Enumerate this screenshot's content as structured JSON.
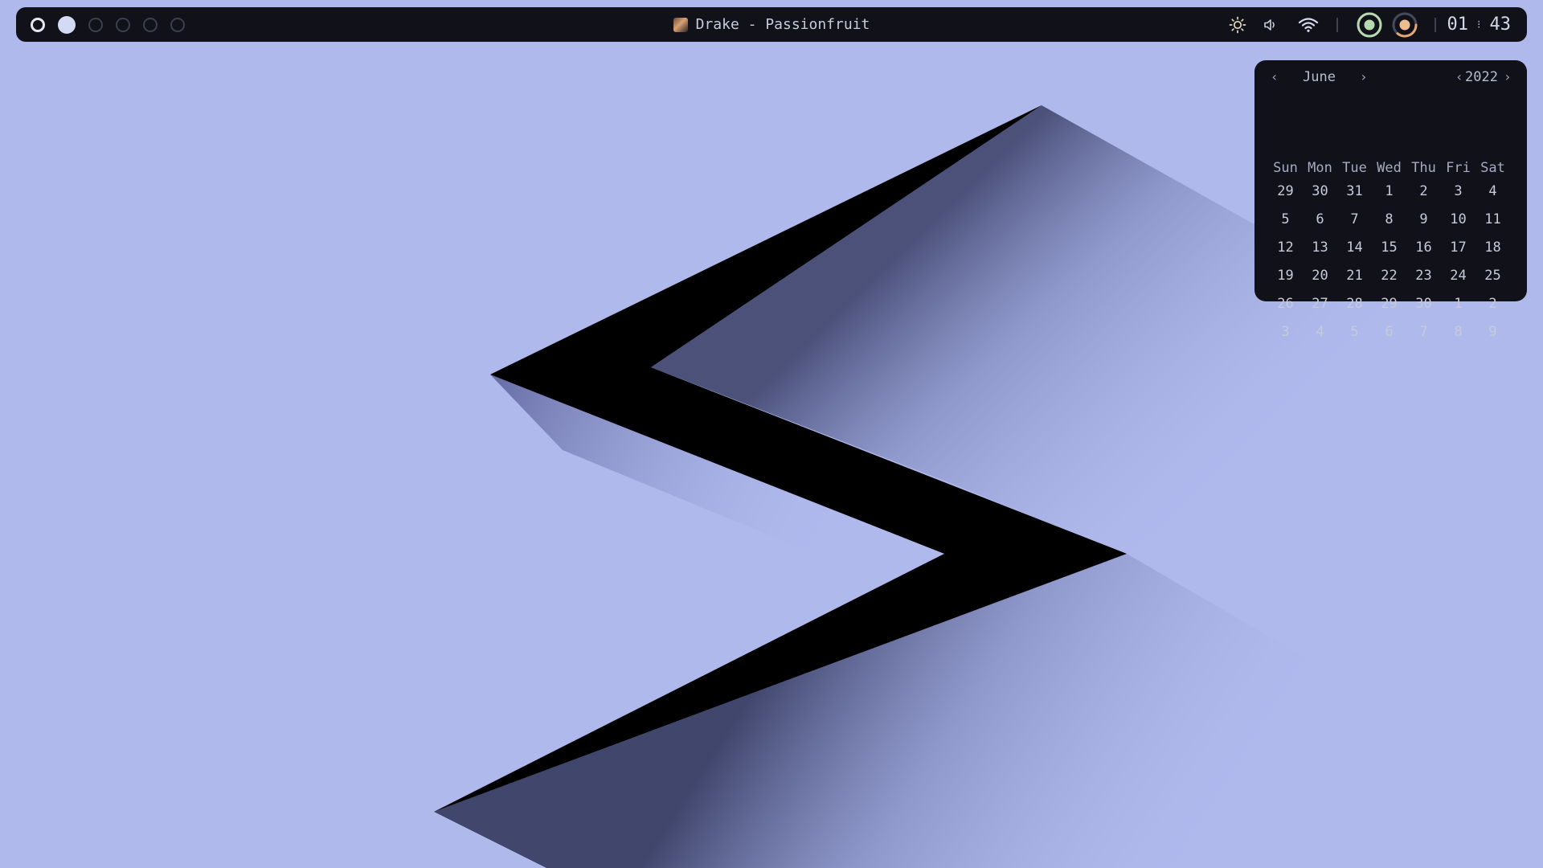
{
  "desktop": {
    "background_color": "#afb9ec"
  },
  "topbar": {
    "workspaces": [
      {
        "state": "active"
      },
      {
        "state": "occupied"
      },
      {
        "state": "empty"
      },
      {
        "state": "empty"
      },
      {
        "state": "empty"
      },
      {
        "state": "empty"
      }
    ],
    "now_playing": "Drake - Passionfruit",
    "status_icons": [
      "brightness-icon",
      "volume-icon",
      "wifi-icon"
    ],
    "indicators": [
      "ring-indicator-green",
      "ring-indicator-orange"
    ],
    "clock": {
      "hours": "01",
      "separator": "⁝",
      "minutes": "43"
    }
  },
  "calendar": {
    "prev_month": "‹",
    "month": "June",
    "next_month": "›",
    "prev_year": "‹",
    "year": "2022",
    "next_year": "›",
    "weekdays": [
      "Sun",
      "Mon",
      "Tue",
      "Wed",
      "Thu",
      "Fri",
      "Sat"
    ],
    "weeks": [
      [
        "29",
        "30",
        "31",
        "1",
        "2",
        "3",
        "4"
      ],
      [
        "5",
        "6",
        "7",
        "8",
        "9",
        "10",
        "11"
      ],
      [
        "12",
        "13",
        "14",
        "15",
        "16",
        "17",
        "18"
      ],
      [
        "19",
        "20",
        "21",
        "22",
        "23",
        "24",
        "25"
      ],
      [
        "26",
        "27",
        "28",
        "29",
        "30",
        "1",
        "2"
      ],
      [
        "3",
        "4",
        "5",
        "6",
        "7",
        "8",
        "9"
      ]
    ]
  },
  "colors": {
    "bar": "#101119",
    "text": "#c8ccda",
    "accent_green": "#a6d189",
    "accent_orange": "#e5a672"
  }
}
